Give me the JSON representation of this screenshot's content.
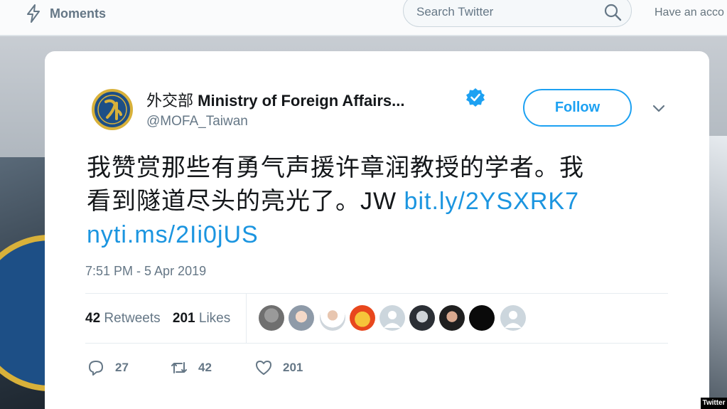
{
  "nav": {
    "moments_label": "Moments",
    "search_placeholder": "Search Twitter",
    "account_prompt": "Have an acco"
  },
  "tweet": {
    "display_name_cn": "外交部",
    "display_name_en": "Ministry of Foreign Affairs...",
    "handle": "@MOFA_Taiwan",
    "follow_label": "Follow",
    "text_line1": "我赞赏那些有勇气声援许章润教授的学者。我",
    "text_line2": "看到隧道尽头的亮光了。JW ",
    "link1": "bit.ly/2YSXRK7",
    "link2": "nyti.ms/2Ii0jUS",
    "timestamp": "7:51 PM - 5 Apr 2019",
    "retweets_count": "42",
    "retweets_label": "Retweets",
    "likes_count": "201",
    "likes_label": "Likes",
    "reply_count": "27",
    "retweet_action_count": "42",
    "like_action_count": "201"
  },
  "icons": {
    "moments": "lightning-icon",
    "search": "search-icon",
    "verified": "verified-badge-icon",
    "caret": "chevron-down-icon",
    "reply": "reply-icon",
    "retweet": "retweet-icon",
    "like": "heart-icon"
  },
  "colors": {
    "brand_blue": "#1da1f2",
    "link_blue": "#1b95e0",
    "text_dark": "#14171a",
    "text_gray": "#657786"
  },
  "watermark": "Twitter"
}
